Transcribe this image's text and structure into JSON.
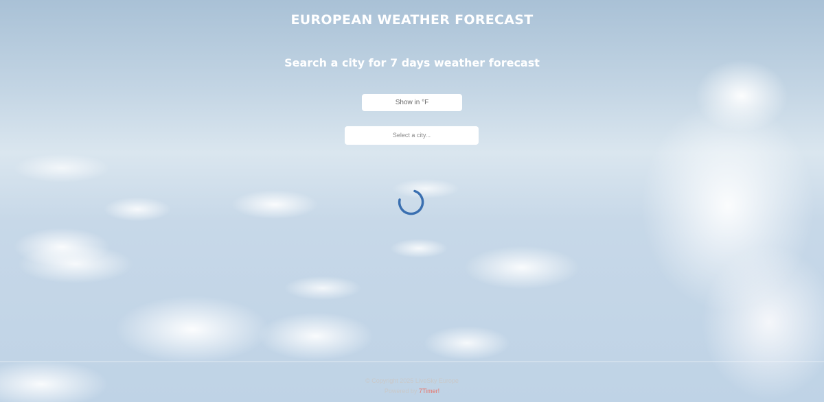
{
  "header": {
    "title": "EUROPEAN WEATHER FORECAST",
    "subtitle": "Search a city for 7 days weather forecast"
  },
  "controls": {
    "unit_toggle_label": "Show in °F",
    "city_select_placeholder": "Select a city..."
  },
  "status": {
    "loading_icon": "loading-spinner"
  },
  "footer": {
    "copyright": "© Copyright 2025 LiveSky Europe",
    "powered_by_label": "Powered by",
    "powered_by_link": "7Timer!"
  },
  "colors": {
    "spinner": "#3a6fb0",
    "link": "#e8746a"
  }
}
